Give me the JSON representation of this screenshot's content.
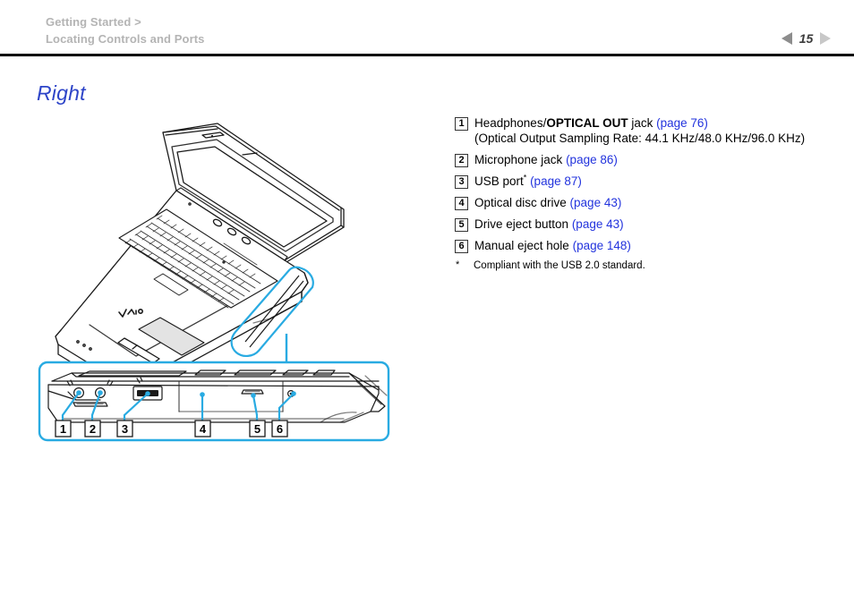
{
  "header": {
    "breadcrumb_line1": "Getting Started >",
    "breadcrumb_line2": "Locating Controls and Ports",
    "page_number": "15",
    "prev_icon": "triangle-left-icon",
    "next_icon": "triangle-right-icon"
  },
  "page": {
    "title": "Right"
  },
  "spec_list": [
    {
      "num": "1",
      "pre": "Headphones/",
      "bold": "OPTICAL OUT",
      "post": " jack ",
      "link": "(page 76)",
      "sub": "(Optical Output Sampling Rate: 44.1 KHz/48.0 KHz/96.0 KHz)"
    },
    {
      "num": "2",
      "pre": "Microphone jack ",
      "bold": "",
      "post": "",
      "link": "(page 86)",
      "sub": ""
    },
    {
      "num": "3",
      "pre": "USB port",
      "bold": "",
      "post": " ",
      "star": "*",
      "link": "(page 87)",
      "sub": ""
    },
    {
      "num": "4",
      "pre": "Optical disc drive ",
      "bold": "",
      "post": "",
      "link": "(page 43)",
      "sub": ""
    },
    {
      "num": "5",
      "pre": "Drive eject button ",
      "bold": "",
      "post": "",
      "link": "(page 43)",
      "sub": ""
    },
    {
      "num": "6",
      "pre": "Manual eject hole ",
      "bold": "",
      "post": "",
      "link": "(page 148)",
      "sub": ""
    }
  ],
  "footnote": {
    "mark": "*",
    "text": "Compliant with the USB 2.0 standard."
  },
  "illustration": {
    "type": "laptop-line-drawing",
    "description": "VAIO notebook computer, open, viewed from front-left; right edge highlighted in blue",
    "logo_text": "VAIO",
    "callout_labels": [
      "1",
      "2",
      "3",
      "4",
      "5",
      "6"
    ],
    "callout_description": "Right side close-up view showing headphone jack, microphone jack, USB port, optical disc drive, drive eject button and manual eject hole"
  },
  "colors": {
    "title_blue": "#2d44c8",
    "link_blue": "#2233dd",
    "highlight_cyan": "#29abe2",
    "breadcrumb_gray": "#b4b4b4",
    "rule_black": "#000000",
    "line_art": "#1a1a1a"
  }
}
